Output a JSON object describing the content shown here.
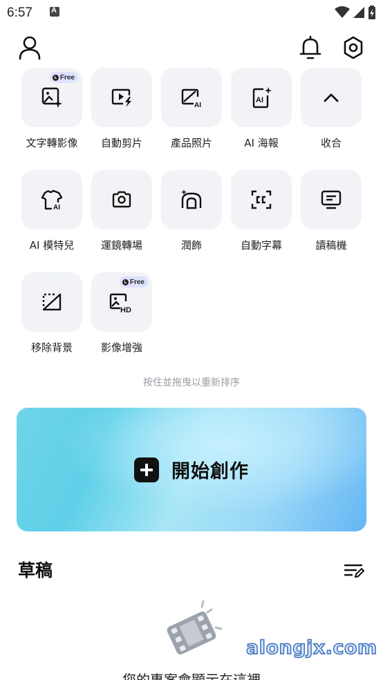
{
  "status_bar": {
    "time": "6:57"
  },
  "tools": [
    {
      "label": "文字轉影像",
      "icon": "text-to-image-icon",
      "free": "Free"
    },
    {
      "label": "自動剪片",
      "icon": "auto-cut-icon"
    },
    {
      "label": "產品照片",
      "icon": "product-photo-icon"
    },
    {
      "label": "AI 海報",
      "icon": "ai-poster-icon"
    },
    {
      "label": "收合",
      "icon": "chevron-up-icon"
    },
    {
      "label": "AI 模特兒",
      "icon": "ai-model-icon"
    },
    {
      "label": "運鏡轉場",
      "icon": "camera-transition-icon"
    },
    {
      "label": "潤飾",
      "icon": "retouch-icon"
    },
    {
      "label": "自動字幕",
      "icon": "auto-caption-icon"
    },
    {
      "label": "讀稿機",
      "icon": "teleprompter-icon"
    },
    {
      "label": "移除背景",
      "icon": "remove-background-icon"
    },
    {
      "label": "影像增強",
      "icon": "image-enhance-icon",
      "free": "Free"
    }
  ],
  "hint": "按住並拖曳以重新排序",
  "start": {
    "label": "開始創作"
  },
  "drafts": {
    "title": "草稿",
    "empty_text": "您的專案會顯示在這裡"
  },
  "watermark": "alongjx.com"
}
